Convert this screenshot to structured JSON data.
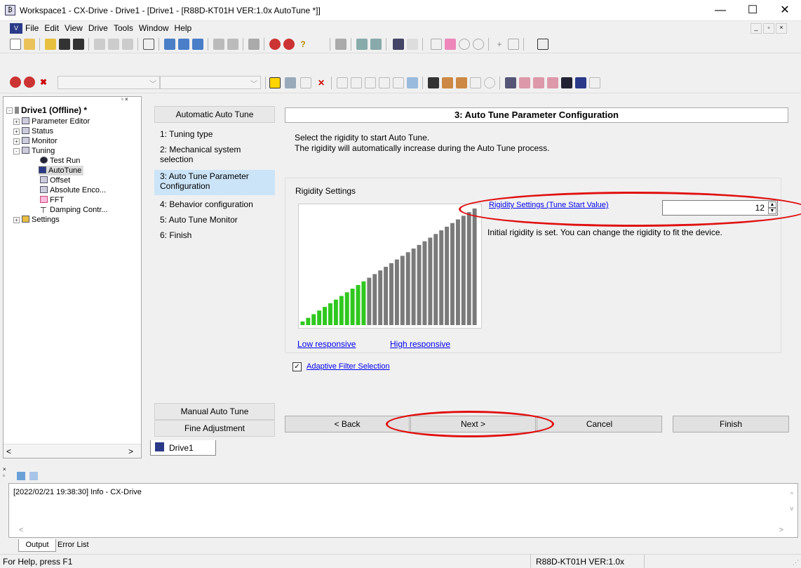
{
  "window": {
    "title": "Workspace1 - CX-Drive - Drive1 - [Drive1 - [R88D-KT01H VER:1.0x AutoTune *]]",
    "minimize": "—",
    "maximize": "☐",
    "close": "✕"
  },
  "menubar": {
    "items": [
      "File",
      "Edit",
      "View",
      "Drive",
      "Tools",
      "Window",
      "Help"
    ]
  },
  "tree": {
    "root": "Drive1 (Offline) *",
    "items": [
      "Parameter Editor",
      "Status",
      "Monitor",
      "Tuning",
      "Test Run",
      "AutoTune",
      "Offset",
      "Absolute Enco...",
      "FFT",
      "Damping Contr...",
      "Settings"
    ]
  },
  "wizard": {
    "nav_header": "Automatic Auto Tune",
    "steps": [
      "1: Tuning type",
      "2: Mechanical system selection",
      "3: Auto Tune Parameter Configuration",
      "4: Behavior configuration",
      "5: Auto Tune Monitor",
      "6: Finish"
    ],
    "nav_footer_1": "Manual Auto Tune",
    "nav_footer_2": "Fine Adjustment",
    "panel_title": "3: Auto Tune Parameter Configuration",
    "intro_line1": "Select the rigidity to start Auto Tune.",
    "intro_line2": "The rigidity will automatically increase during the Auto Tune process.",
    "group_title": "Rigidity Settings",
    "rigidity_link": "Rigidity Settings (Tune Start Value)",
    "rigidity_value": "12",
    "rigidity_total_levels": 32,
    "rigidity_note": "Initial rigidity is set. You can change the rigidity to fit the device.",
    "low_link": "Low responsive",
    "high_link": "High responsive",
    "adaptive_filter": "Adaptive Filter Selection",
    "adaptive_checked": "☑",
    "back": "< Back",
    "next": "Next >",
    "cancel": "Cancel",
    "finish": "Finish"
  },
  "doc_tab": "Drive1",
  "output": {
    "log_line": "[2022/02/21 19:38:30] Info  - CX-Drive",
    "tab_output": "Output",
    "tab_errors": "Error List"
  },
  "status": {
    "left": "For Help, press F1",
    "device": "R88D-KT01H VER:1.0x"
  },
  "colors": {
    "bar_active": "#2fc81e",
    "bar_inactive": "#7a7a7a",
    "highlight_oval": "#e01010",
    "selected_step": "#cce4f7"
  }
}
